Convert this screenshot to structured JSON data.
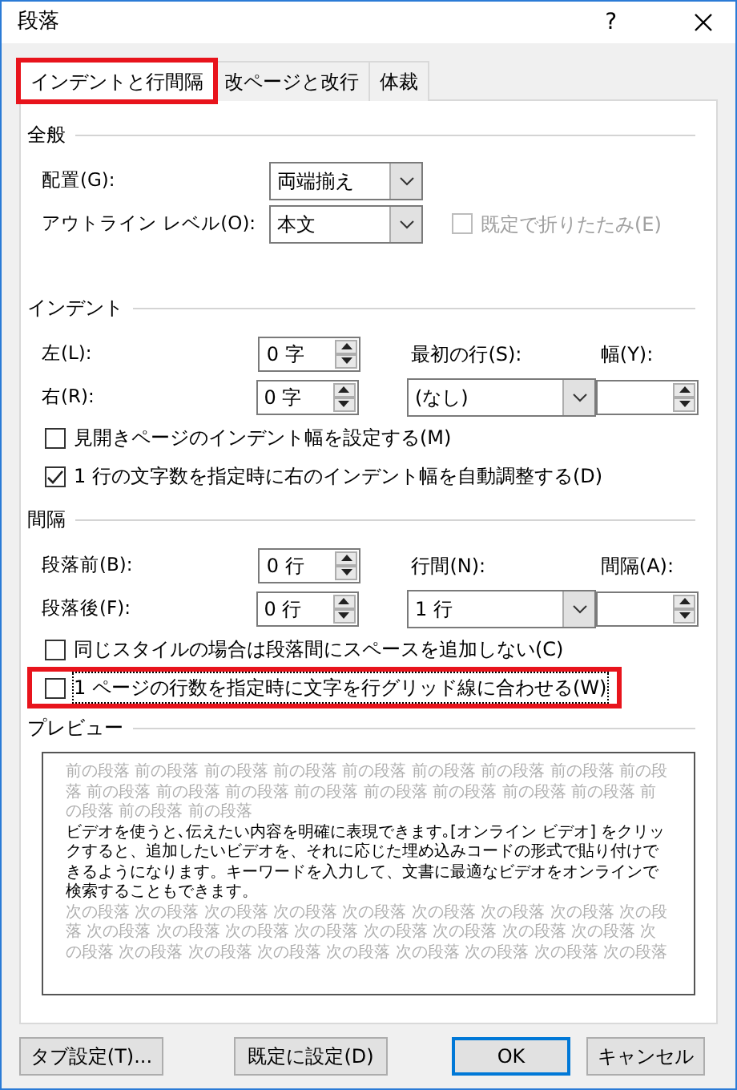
{
  "window": {
    "title": "段落",
    "help": "?"
  },
  "tabs": [
    {
      "label": "インデントと行間隔",
      "selected": true,
      "highlighted": true
    },
    {
      "label": "改ページと改行",
      "selected": false,
      "highlighted": false
    },
    {
      "label": "体裁",
      "selected": false,
      "highlighted": false
    }
  ],
  "sections": [
    {
      "heading": "全般",
      "rows": [
        [
          {
            "kind": "label",
            "text": "配置(G):"
          },
          {
            "kind": "dropdown",
            "value": "両端揃え"
          }
        ],
        [
          {
            "kind": "label",
            "text": "アウトライン レベル(O):"
          },
          {
            "kind": "dropdown",
            "value": "本文"
          },
          {
            "kind": "checkbox",
            "label": "既定で折りたたみ(E)",
            "checked": false,
            "disabled": true,
            "highlighted": false,
            "focused": false
          }
        ]
      ]
    },
    {
      "heading": "インデント",
      "rows": [
        [
          {
            "kind": "label",
            "text": "左(L):"
          },
          {
            "kind": "spinner",
            "value": "0 字"
          },
          {
            "kind": "label",
            "text": "最初の行(S):"
          },
          {
            "kind": "label",
            "text": "幅(Y):"
          }
        ],
        [
          {
            "kind": "label",
            "text": "右(R):"
          },
          {
            "kind": "spinner",
            "value": "0 字"
          },
          {
            "kind": "dropdown",
            "value": "(なし)"
          },
          {
            "kind": "spinner"
          }
        ],
        [
          {
            "kind": "checkbox",
            "label": "見開きページのインデント幅を設定する(M)",
            "checked": false,
            "disabled": false,
            "highlighted": false,
            "focused": false
          }
        ],
        [
          {
            "kind": "checkbox",
            "label": "1 行の文字数を指定時に右のインデント幅を自動調整する(D)",
            "checked": true,
            "disabled": false,
            "highlighted": false,
            "focused": false
          }
        ]
      ]
    },
    {
      "heading": "間隔",
      "rows": [
        [
          {
            "kind": "label",
            "text": "段落前(B):"
          },
          {
            "kind": "spinner",
            "value": "0 行"
          },
          {
            "kind": "label",
            "text": "行間(N):"
          },
          {
            "kind": "label",
            "text": "間隔(A):"
          }
        ],
        [
          {
            "kind": "label",
            "text": "段落後(F):"
          },
          {
            "kind": "spinner",
            "value": "0 行"
          },
          {
            "kind": "dropdown",
            "value": "1 行"
          },
          {
            "kind": "spinner"
          }
        ],
        [
          {
            "kind": "checkbox",
            "label": "同じスタイルの場合は段落間にスペースを追加しない(C)",
            "checked": false,
            "disabled": false,
            "highlighted": false,
            "focused": false
          }
        ],
        [
          {
            "kind": "checkbox",
            "label": "1 ページの行数を指定時に文字を行グリッド線に合わせる(W)",
            "checked": false,
            "disabled": false,
            "highlighted": true,
            "focused": true
          }
        ]
      ]
    }
  ],
  "preview": {
    "heading": "プレビュー",
    "paragraphs": [
      {
        "kind": "previous",
        "text": "前の段落 前の段落 前の段落 前の段落 前の段落 前の段落 前の段落 前の段落 前の段落 前の段落 前の段落 前の段落 前の段落 前の段落 前の段落 前の段落 前の段落 前の段落 前の段落 前の段落"
      },
      {
        "kind": "current",
        "text": "ビデオを使うと､伝えたい内容を明確に表現できます｡[オンライン ビデオ] をクリックすると、追加したいビデオを、それに応じた埋め込みコードの形式で貼り付けできるようになります。キーワードを入力して、文書に最適なビデオをオンラインで検索することもできます。"
      },
      {
        "kind": "next",
        "text": "次の段落 次の段落 次の段落 次の段落 次の段落 次の段落 次の段落 次の段落 次の段落 次の段落 次の段落 次の段落 次の段落 次の段落 次の段落 次の段落 次の段落 次の段落 次の段落 次の段落 次の段落 次の段落 次の段落 次の段落 次の段落 次の段落"
      }
    ]
  },
  "buttons": [
    {
      "label": "タブ設定(T)...",
      "focused": false
    },
    {
      "label": "既定に設定(D)",
      "focused": false
    },
    {
      "label": "OK",
      "focused": true
    },
    {
      "label": "キャンセル",
      "focused": false
    }
  ]
}
